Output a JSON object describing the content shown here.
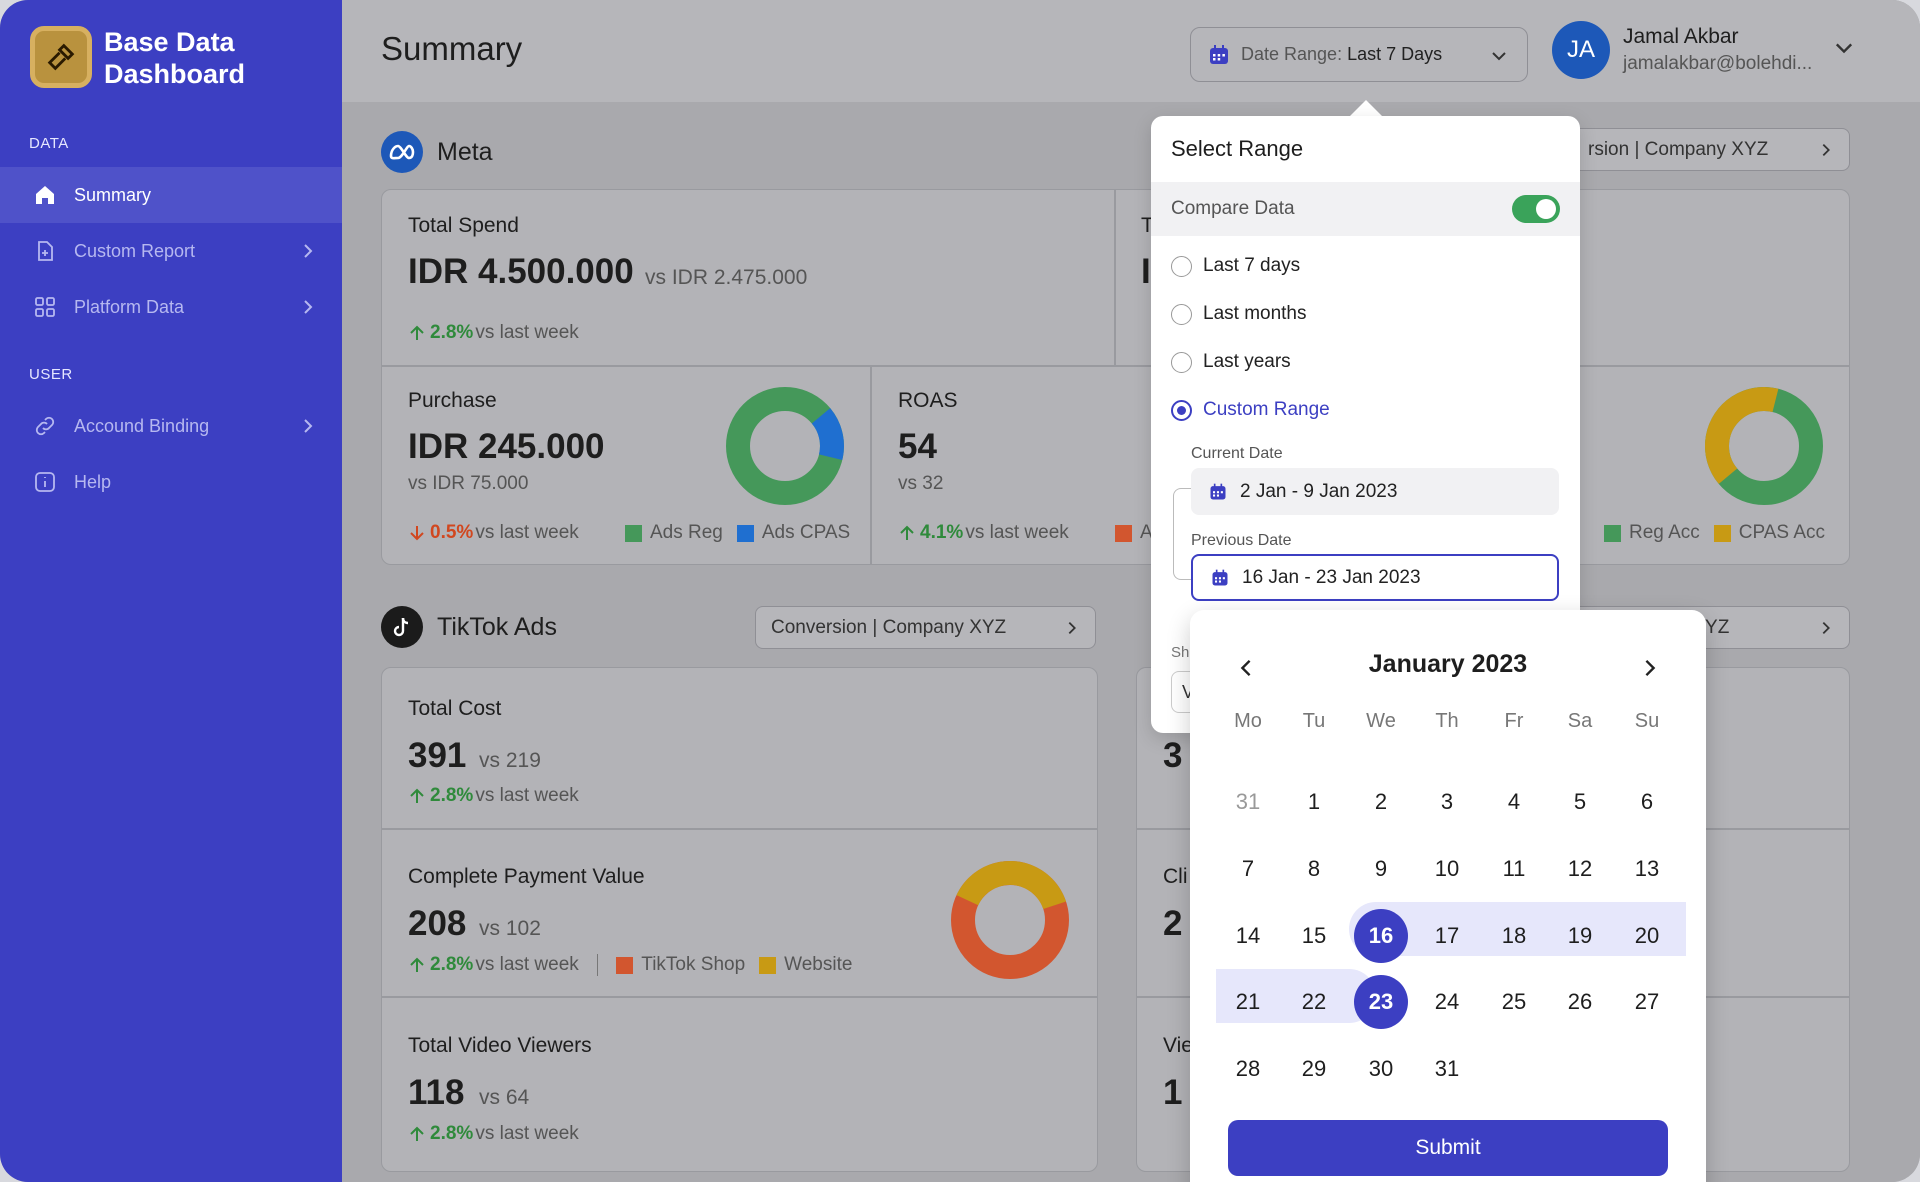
{
  "sidebar": {
    "brand_line1": "Base Data",
    "brand_line2": "Dashboard",
    "section_data": "DATA",
    "section_user": "USER",
    "items": [
      {
        "label": "Summary",
        "icon": "home-icon"
      },
      {
        "label": "Custom Report",
        "icon": "report-icon"
      },
      {
        "label": "Platform Data",
        "icon": "grid-icon"
      },
      {
        "label": "Accound Binding",
        "icon": "link-icon"
      },
      {
        "label": "Help",
        "icon": "info-icon"
      }
    ]
  },
  "header": {
    "title": "Summary",
    "date_range_label": "Date Range:",
    "date_range_value": "Last 7 Days",
    "user_initials": "JA",
    "user_name": "Jamal Akbar",
    "user_email": "jamalakbar@bolehdi..."
  },
  "meta": {
    "title": "Meta",
    "selector": "rsion | Company XYZ",
    "total_spend": {
      "label": "Total Spend",
      "value": "IDR 4.500.000",
      "vs": "vs IDR 2.475.000",
      "pct": "2.8%",
      "suffix": "vs last week"
    },
    "cut_label": "T",
    "cut_value": "I",
    "purchase": {
      "label": "Purchase",
      "value": "IDR 245.000",
      "vs": "vs IDR 75.000",
      "pct": "0.5%",
      "suffix": "vs last week",
      "legend1": "Ads Reg",
      "legend2": "Ads CPAS"
    },
    "roas": {
      "label": "ROAS",
      "value": "54",
      "vs": "vs 32",
      "pct": "4.1%",
      "suffix": "vs last week",
      "legend_cut": "A"
    },
    "acc_legend1": "Reg Acc",
    "acc_legend2": "CPAS Acc"
  },
  "tiktok": {
    "title": "TikTok Ads",
    "selector": "Conversion | Company XYZ",
    "selector_right": "ny XYZ",
    "total_cost": {
      "label": "Total Cost",
      "value": "391",
      "vs": "vs 219",
      "pct": "2.8%",
      "suffix": "vs last week"
    },
    "complete_payment": {
      "label": "Complete Payment Value",
      "value": "208",
      "vs": "vs 102",
      "pct": "2.8%",
      "suffix": "vs last week",
      "legend1": "TikTok Shop",
      "legend2": "Website"
    },
    "video_viewers": {
      "label": "Total Video Viewers",
      "value": "118",
      "vs": "vs 64",
      "pct": "2.8%",
      "suffix": "vs last week"
    },
    "right_cut1": "3",
    "right_cut2_label": "Cli",
    "right_cut2_value": "2",
    "right_cut3_label": "Vie",
    "right_cut3_value": "1",
    "sh_cut": "Sh",
    "v_cut": "V"
  },
  "popover": {
    "title": "Select Range",
    "compare_label": "Compare Data",
    "compare_on": true,
    "options": [
      "Last 7 days",
      "Last months",
      "Last years",
      "Custom Range"
    ],
    "selected_option": "Custom Range",
    "current_label": "Current Date",
    "current_value": "2 Jan - 9 Jan 2023",
    "previous_label": "Previous Date",
    "previous_value": "16 Jan - 23 Jan 2023"
  },
  "calendar": {
    "title": "January 2023",
    "weekdays": [
      "Mo",
      "Tu",
      "We",
      "Th",
      "Fr",
      "Sa",
      "Su"
    ],
    "weeks": [
      [
        "31",
        "1",
        "2",
        "3",
        "4",
        "5",
        "6"
      ],
      [
        "7",
        "8",
        "9",
        "10",
        "11",
        "12",
        "13"
      ],
      [
        "14",
        "15",
        "16",
        "17",
        "18",
        "19",
        "20"
      ],
      [
        "21",
        "22",
        "23",
        "24",
        "25",
        "26",
        "27"
      ],
      [
        "28",
        "29",
        "30",
        "31"
      ]
    ],
    "range_start": "16",
    "range_end": "23",
    "submit_label": "Submit"
  },
  "colors": {
    "accent": "#3c3fc2",
    "positive": "#2f8a3b",
    "negative": "#d1471f",
    "donut_green": "#45985a",
    "donut_blue": "#1f6fd0",
    "donut_orange": "#d2562f",
    "donut_gold": "#c89a14"
  }
}
